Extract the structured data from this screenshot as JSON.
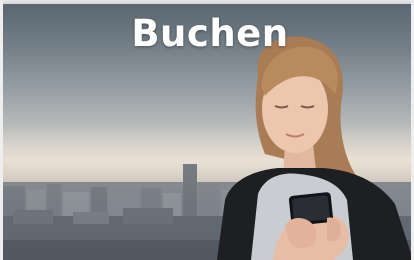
{
  "banner": {
    "title": "Buchen"
  },
  "image": {
    "subject": "woman-using-smartphone-city-skyline",
    "colors": {
      "sky_top": "#5a6670",
      "horizon": "#d8d2c8",
      "hair": "#b98a5e",
      "cardigan": "#1e1f22",
      "top": "#c9ccd0"
    }
  }
}
